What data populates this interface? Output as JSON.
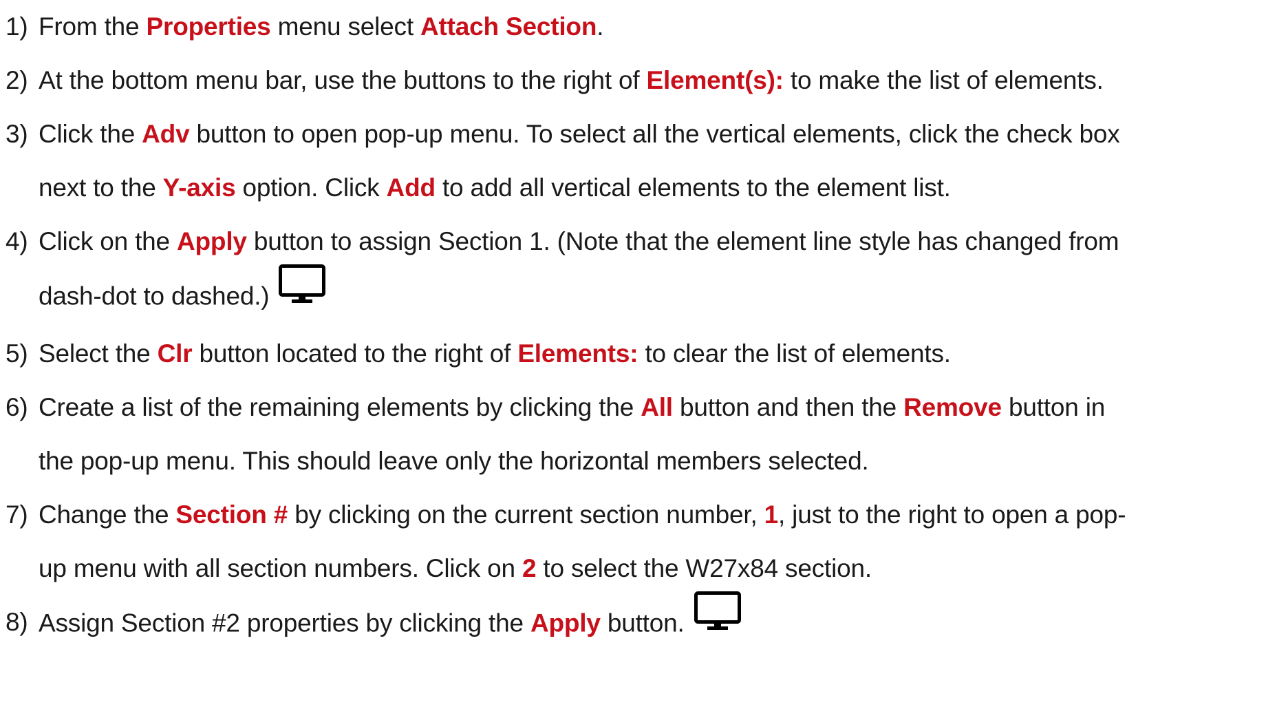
{
  "steps": [
    {
      "number": "1)",
      "lines": [
        [
          {
            "t": "From the "
          },
          {
            "t": "Properties",
            "kw": true
          },
          {
            "t": " menu select "
          },
          {
            "t": "Attach Section",
            "kw": true
          },
          {
            "t": "."
          }
        ]
      ]
    },
    {
      "number": "2)",
      "lines": [
        [
          {
            "t": "At the bottom menu bar, use the buttons to the right of "
          },
          {
            "t": "Element(s):",
            "kw": true
          },
          {
            "t": " to make the list of elements."
          }
        ]
      ]
    },
    {
      "number": "3)",
      "lines": [
        [
          {
            "t": "Click the "
          },
          {
            "t": "Adv",
            "kw": true
          },
          {
            "t": " button to open pop-up menu. To select all the vertical elements, click the check box"
          }
        ],
        [
          {
            "t": "next to the "
          },
          {
            "t": "Y-axis",
            "kw": true
          },
          {
            "t": " option. Click "
          },
          {
            "t": "Add",
            "kw": true
          },
          {
            "t": " to add all vertical elements to the element list."
          }
        ]
      ]
    },
    {
      "number": "4)",
      "lines": [
        [
          {
            "t": "Click on the "
          },
          {
            "t": "Apply",
            "kw": true
          },
          {
            "t": " button to assign Section 1. (Note that the element line style has changed from"
          }
        ],
        [
          {
            "t": "dash-dot to dashed.)"
          }
        ]
      ],
      "icon": "monitor-icon"
    },
    {
      "number": "5)",
      "lines": [
        [
          {
            "t": "Select the "
          },
          {
            "t": "Clr",
            "kw": true
          },
          {
            "t": " button located to the right of "
          },
          {
            "t": "Elements:",
            "kw": true
          },
          {
            "t": " to clear the list of elements."
          }
        ]
      ]
    },
    {
      "number": "6)",
      "lines": [
        [
          {
            "t": "Create a list of the remaining elements by clicking the "
          },
          {
            "t": "All",
            "kw": true
          },
          {
            "t": " button and then the "
          },
          {
            "t": "Remove",
            "kw": true
          },
          {
            "t": " button in"
          }
        ],
        [
          {
            "t": "the pop-up menu. This should leave only the horizontal members selected."
          }
        ]
      ]
    },
    {
      "number": "7)",
      "lines": [
        [
          {
            "t": "Change the "
          },
          {
            "t": "Section #",
            "kw": true
          },
          {
            "t": " by clicking on the current section number, "
          },
          {
            "t": "1",
            "kw": true
          },
          {
            "t": ", just to the right to open a pop-"
          }
        ],
        [
          {
            "t": "up menu with all section numbers. Click on "
          },
          {
            "t": "2",
            "kw": true
          },
          {
            "t": " to select the W27x84 section."
          }
        ]
      ]
    },
    {
      "number": "8)",
      "lines": [
        [
          {
            "t": "Assign Section #2 properties by clicking the "
          },
          {
            "t": "Apply",
            "kw": true
          },
          {
            "t": " button."
          }
        ]
      ],
      "icon": "monitor-icon"
    }
  ],
  "colors": {
    "keyword": "#c8101a",
    "text": "#1a1a1a",
    "background": "#ffffff"
  }
}
